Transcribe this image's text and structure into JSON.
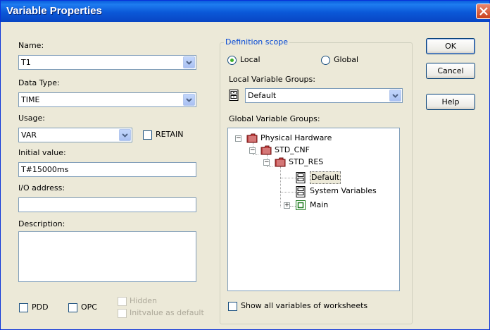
{
  "window": {
    "title": "Variable Properties"
  },
  "left": {
    "name_label": "Name:",
    "name_value": "T1",
    "datatype_label": "Data Type:",
    "datatype_value": "TIME",
    "usage_label": "Usage:",
    "usage_value": "VAR",
    "retain_label": "RETAIN",
    "initial_label": "Initial value:",
    "initial_value": "T#15000ms",
    "io_label": "I/O address:",
    "io_value": "",
    "description_label": "Description:",
    "description_value": "",
    "pdd_label": "PDD",
    "opc_label": "OPC",
    "hidden_label": "Hidden",
    "initvalue_default_label": "Initvalue as default"
  },
  "scope": {
    "group_title": "Definition scope",
    "local_label": "Local",
    "global_label": "Global",
    "selected": "Local",
    "local_groups_label": "Local Variable Groups:",
    "local_groups_value": "Default",
    "global_groups_label": "Global Variable Groups:",
    "tree": [
      {
        "label": "Physical Hardware",
        "level": 0,
        "expander": "minus"
      },
      {
        "label": "STD_CNF",
        "level": 1,
        "expander": "minus"
      },
      {
        "label": "STD_RES",
        "level": 2,
        "expander": "minus"
      },
      {
        "label": "Default",
        "level": 3,
        "expander": "none",
        "selected": true
      },
      {
        "label": "System Variables",
        "level": 3,
        "expander": "none"
      },
      {
        "label": "Main",
        "level": 3,
        "expander": "plus"
      }
    ],
    "show_all_label": "Show all variables of worksheets"
  },
  "buttons": {
    "ok": "OK",
    "cancel": "Cancel",
    "help": "Help"
  },
  "colors": {
    "titlebar": "#0A5DDC",
    "dialog_bg": "#ECE9D8",
    "group_title": "#0046D5",
    "radio_dot": "#3DAF2A",
    "field_border": "#7F9DB9"
  }
}
